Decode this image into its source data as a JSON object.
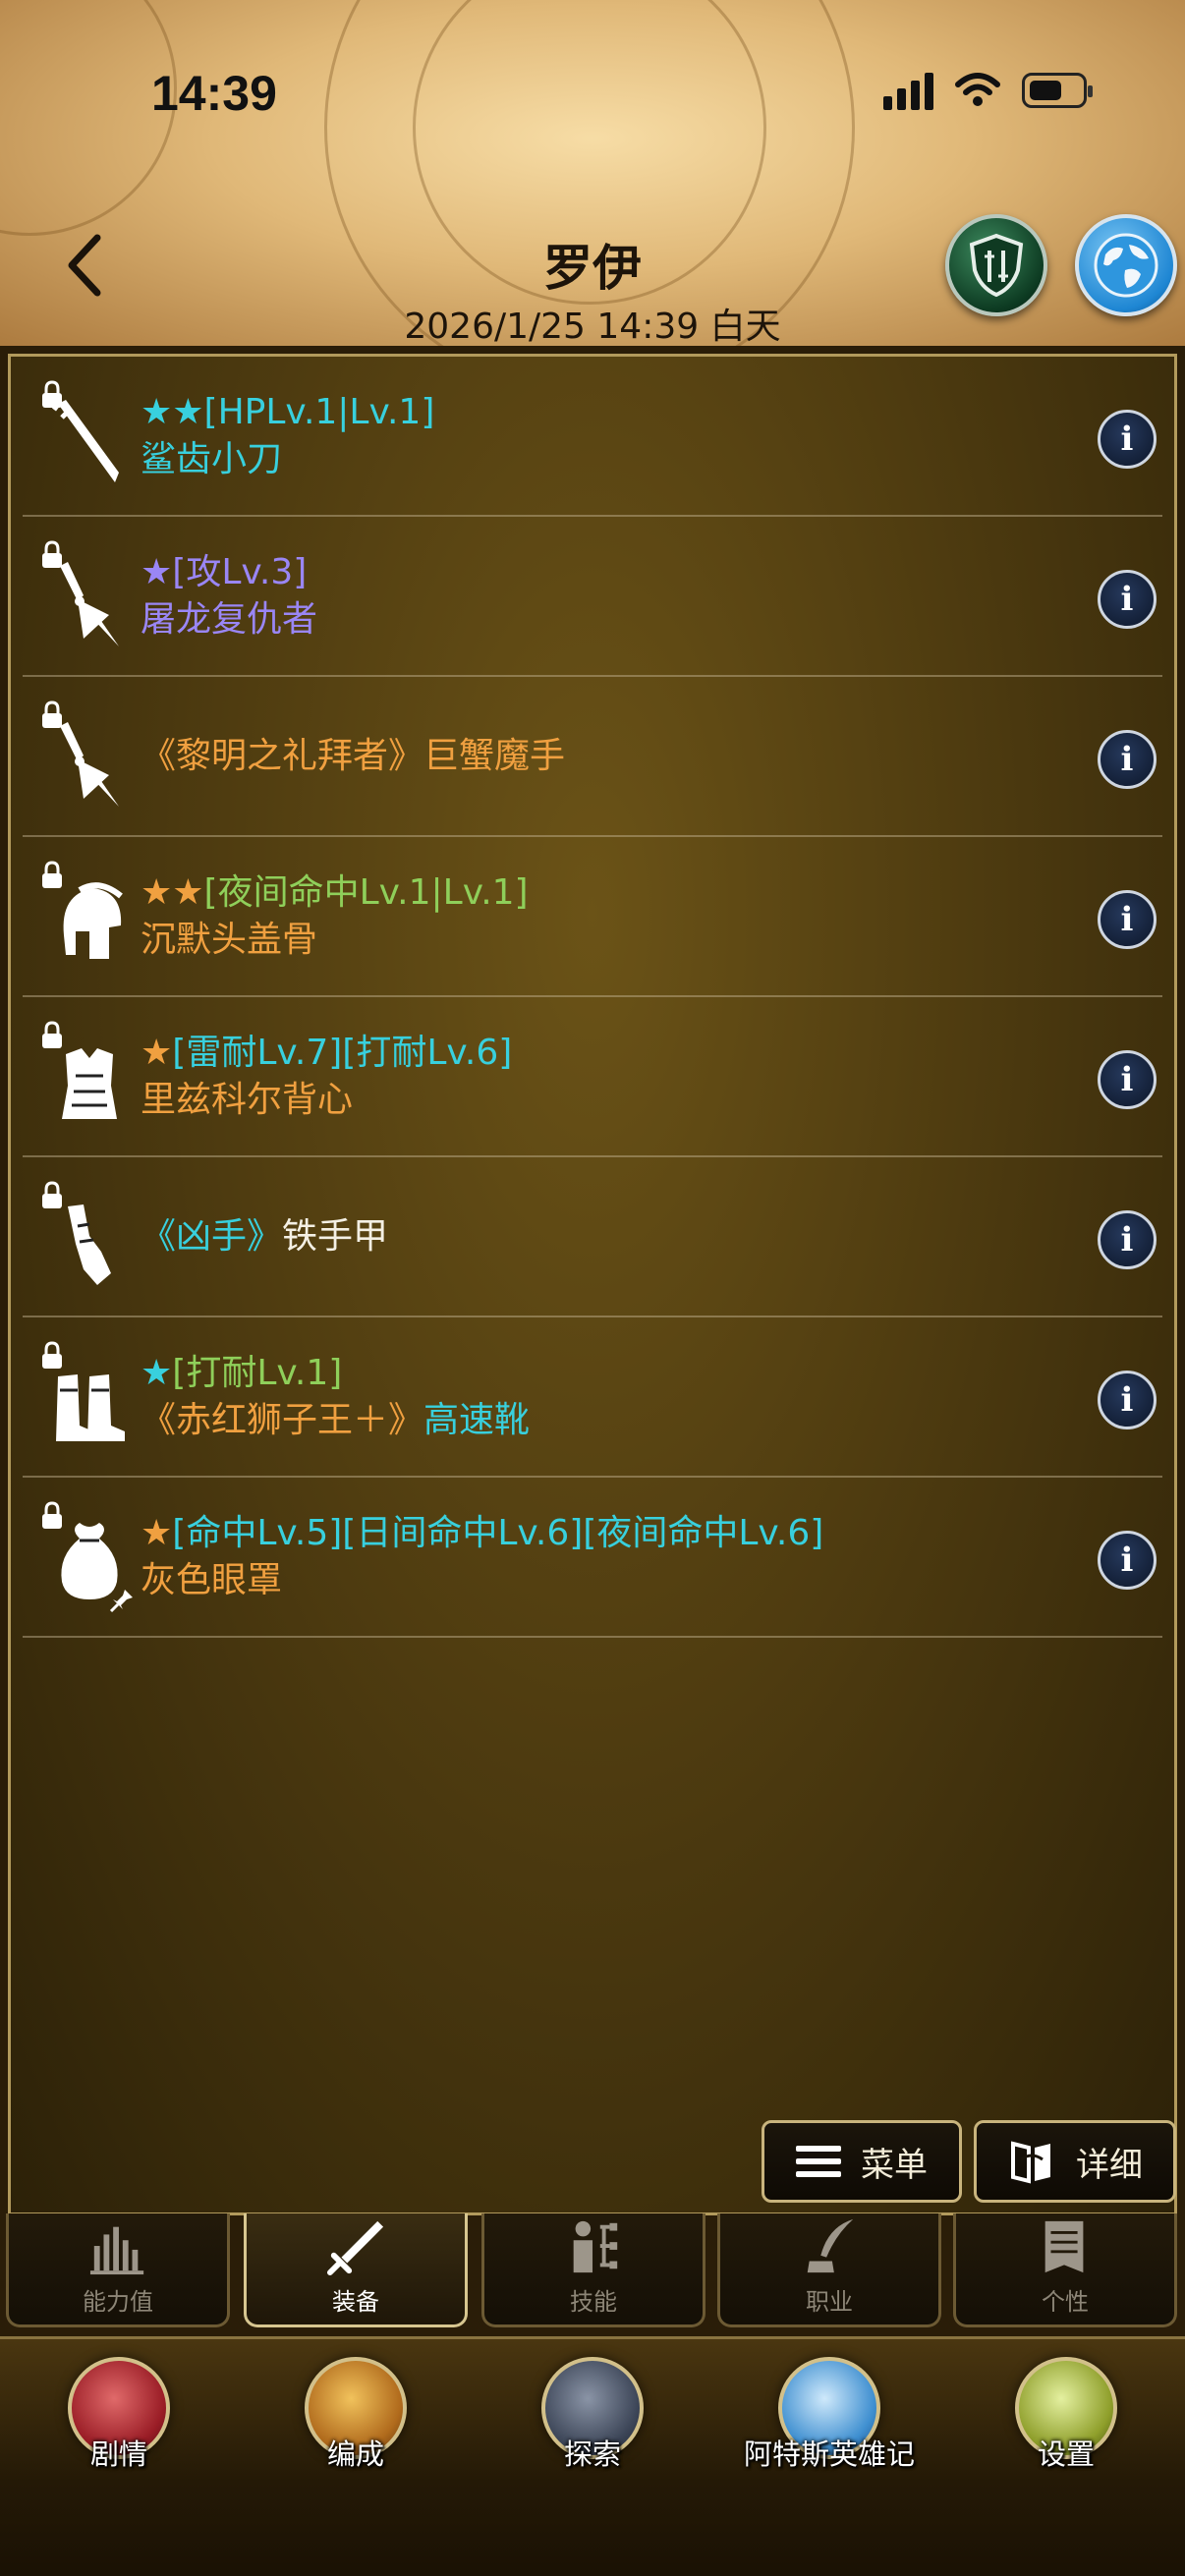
{
  "status_bar": {
    "time": "14:39"
  },
  "header": {
    "title": "罗伊",
    "subtitle": "2026/1/25 14:39 白天"
  },
  "equipment": [
    {
      "icon": "dagger-icon",
      "mods": "★★[HPLv.1|Lv.1]",
      "mods_color": "#38d0de",
      "name": "鲨齿小刀",
      "name_color": "#38d0de",
      "pinned": false
    },
    {
      "icon": "claw-weapon-icon",
      "mods": "★[攻Lv.3]",
      "mods_color": "#9a86f5",
      "name": "屠龙复仇者",
      "name_color": "#9a86f5",
      "pinned": false
    },
    {
      "icon": "claw-weapon-icon",
      "mods": "",
      "name_parts": [
        {
          "text": "《黎明之礼拜者》巨蟹魔手",
          "color": "#f0a040"
        }
      ],
      "pinned": false
    },
    {
      "icon": "helmet-icon",
      "mods_parts": [
        {
          "text": "★★",
          "color": "#f0a040"
        },
        {
          "text": "[夜间命中Lv.1|Lv.1]",
          "color": "#8fcf5a"
        }
      ],
      "name": "沉默头盖骨",
      "name_color": "#f0a040",
      "pinned": false
    },
    {
      "icon": "armor-vest-icon",
      "mods_parts": [
        {
          "text": "★",
          "color": "#f0a040"
        },
        {
          "text": "[雷耐Lv.7][打耐Lv.6]",
          "color": "#38d0de"
        }
      ],
      "name": "里兹科尔背心",
      "name_color": "#f0a040",
      "pinned": false
    },
    {
      "icon": "gauntlet-icon",
      "mods": "",
      "name_parts": [
        {
          "text": "《凶手》",
          "color": "#38d0de"
        },
        {
          "text": "铁手甲",
          "color": "#f4f0e4"
        }
      ],
      "pinned": false
    },
    {
      "icon": "boots-icon",
      "mods_parts": [
        {
          "text": "★",
          "color": "#38d0de"
        },
        {
          "text": "[打耐Lv.1]",
          "color": "#8fcf5a"
        }
      ],
      "name_parts": [
        {
          "text": "《赤红狮子王＋》",
          "color": "#f0a040"
        },
        {
          "text": "高速靴",
          "color": "#38d0de"
        }
      ],
      "pinned": false
    },
    {
      "icon": "pouch-icon",
      "mods_parts": [
        {
          "text": "★",
          "color": "#f0a040"
        },
        {
          "text": "[命中Lv.5][日间命中Lv.6][夜间命中Lv.6]",
          "color": "#38d0de"
        }
      ],
      "name": "灰色眼罩",
      "name_color": "#f0a040",
      "pinned": true
    }
  ],
  "actions": {
    "menu_label": "菜单",
    "detail_label": "详细"
  },
  "tabs": [
    {
      "label": "能力值",
      "icon": "bar-chart-icon",
      "active": false
    },
    {
      "label": "装备",
      "icon": "sword-icon",
      "active": true
    },
    {
      "label": "技能",
      "icon": "skill-tree-icon",
      "active": false
    },
    {
      "label": "职业",
      "icon": "quill-icon",
      "active": false
    },
    {
      "label": "个性",
      "icon": "scroll-icon",
      "active": false
    }
  ],
  "bottom_nav": [
    {
      "label": "剧情",
      "icon": "dragon-emblem-icon"
    },
    {
      "label": "编成",
      "icon": "eagle-emblem-icon"
    },
    {
      "label": "探索",
      "icon": "map-icon"
    },
    {
      "label": "阿特斯英雄记",
      "icon": "document-icon"
    },
    {
      "label": "设置",
      "icon": "gear-icon"
    }
  ]
}
